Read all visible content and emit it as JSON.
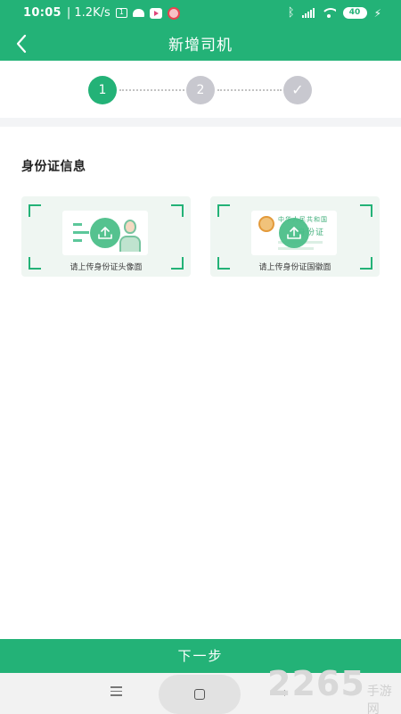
{
  "status_bar": {
    "time": "10:05",
    "speed": "| 1.2K/s",
    "battery": "40"
  },
  "header": {
    "title": "新增司机"
  },
  "stepper": {
    "steps": [
      "1",
      "2",
      "✓"
    ],
    "active_step": 1
  },
  "section": {
    "title": "身份证信息"
  },
  "cards": {
    "front_label": "请上传身份证头像面",
    "back_label": "请上传身份证国徽面",
    "back_card_header": "中华人民共和国",
    "back_card_title": "身份证"
  },
  "actions": {
    "next_label": "下一步"
  },
  "watermark": {
    "number": "2265",
    "text": "手游网"
  },
  "colors": {
    "primary": "#23b277",
    "inactive_step": "#c8c8cf"
  }
}
